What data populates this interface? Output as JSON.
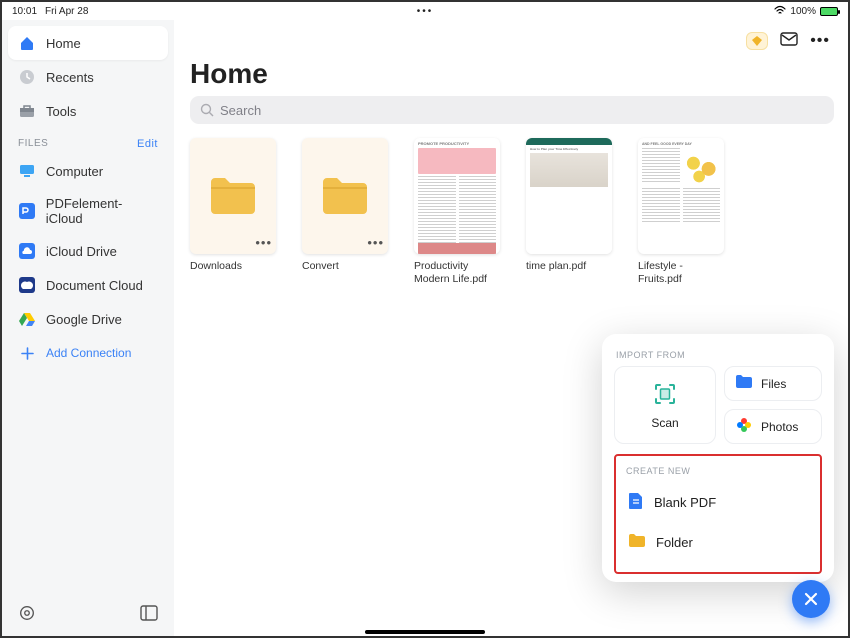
{
  "status": {
    "time": "10:01",
    "date": "Fri Apr 28",
    "battery": "100%"
  },
  "header": {
    "title": "Home"
  },
  "search": {
    "placeholder": "Search"
  },
  "sidebar": {
    "nav": [
      {
        "label": "Home",
        "icon": "home",
        "selected": true
      },
      {
        "label": "Recents",
        "icon": "clock",
        "selected": false
      },
      {
        "label": "Tools",
        "icon": "toolbox",
        "selected": false
      }
    ],
    "files_section": {
      "label": "FILES",
      "edit": "Edit"
    },
    "locations": [
      {
        "label": "Computer",
        "icon": "computer"
      },
      {
        "label": "PDFelement-iCloud",
        "icon": "pdfelement"
      },
      {
        "label": "iCloud Drive",
        "icon": "icloud"
      },
      {
        "label": "Document Cloud",
        "icon": "adobe"
      },
      {
        "label": "Google Drive",
        "icon": "gdrive"
      }
    ],
    "add_connection": "Add Connection"
  },
  "items": [
    {
      "type": "folder",
      "label": "Downloads"
    },
    {
      "type": "folder",
      "label": "Convert"
    },
    {
      "type": "doc",
      "label": "Productivity Modern Life.pdf",
      "variant": "pink"
    },
    {
      "type": "doc",
      "label": "time plan.pdf",
      "variant": "green"
    },
    {
      "type": "doc",
      "label": "Lifestyle - Fruits.pdf",
      "variant": "fruit"
    }
  ],
  "doc_headers": {
    "pink": "PROMOTE PRODUCTIVITY",
    "green": "How to Plan your Time Effectively",
    "fruit": "AND FEEL GOOD EVERY DAY"
  },
  "popover": {
    "import_label": "IMPORT FROM",
    "scan": "Scan",
    "files": "Files",
    "photos": "Photos",
    "create_label": "CREATE NEW",
    "blank_pdf": "Blank PDF",
    "folder": "Folder"
  }
}
